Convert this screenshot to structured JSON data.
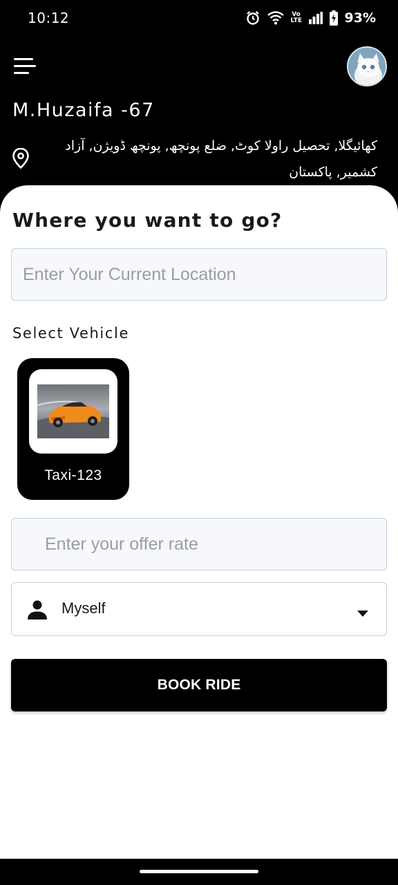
{
  "status_bar": {
    "time": "10:12",
    "network_label": "Vo LTE",
    "battery_percent": "93%",
    "icons": [
      "alarm-icon",
      "wifi-icon",
      "volte-icon",
      "signal-icon",
      "battery-charging-icon"
    ]
  },
  "header": {
    "menu_icon": "hamburger-menu-icon",
    "avatar_icon": "profile-avatar",
    "user_name": "M.Huzaifa -67",
    "location_icon": "map-pin-icon",
    "address": "کھائیگلا, تحصیل راولا کوٹ, ضلع پونچھ, پونچھ ڈویژن, آزاد کشمیر, پاکستان"
  },
  "booking": {
    "title": "Where you want to go?",
    "location_placeholder": "Enter Your Current Location",
    "location_value": "",
    "vehicle_section_label": "Select Vehicle",
    "vehicles": [
      {
        "label": "Taxi-123",
        "icon": "sports-car-image"
      }
    ],
    "offer_rate_placeholder": "Enter your offer rate",
    "offer_rate_value": "",
    "passenger": {
      "icon": "person-icon",
      "selected": "Myself",
      "dropdown_icon": "caret-down-icon"
    },
    "book_button_label": "BOOK RIDE"
  },
  "colors": {
    "header_background": "#000000",
    "sheet_background": "#ffffff",
    "button_background": "#000000",
    "input_border": "#c4cfdc",
    "car_accent": "#f08a1c"
  }
}
